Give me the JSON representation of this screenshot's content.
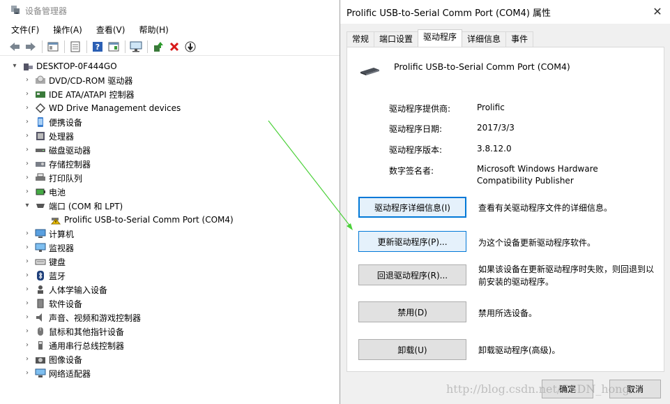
{
  "device_manager": {
    "title": "设备管理器",
    "menu": [
      "文件(F)",
      "操作(A)",
      "查看(V)",
      "帮助(H)"
    ],
    "toolbar_icons": [
      "back-arrow-icon",
      "forward-arrow-icon",
      "show-hide-icon",
      "properties-icon",
      "help-icon",
      "view-icon",
      "monitor-icon",
      "update-driver-icon",
      "uninstall-x-icon",
      "download-icon"
    ],
    "tree": {
      "root": "DESKTOP-0F444GO",
      "items": [
        {
          "label": "DVD/CD-ROM 驱动器",
          "icon": "dvd-drive-icon"
        },
        {
          "label": "IDE ATA/ATAPI 控制器",
          "icon": "ide-controller-icon"
        },
        {
          "label": "WD Drive Management devices",
          "icon": "wd-device-icon"
        },
        {
          "label": "便携设备",
          "icon": "portable-device-icon"
        },
        {
          "label": "处理器",
          "icon": "processor-icon"
        },
        {
          "label": "磁盘驱动器",
          "icon": "disk-drive-icon"
        },
        {
          "label": "存储控制器",
          "icon": "storage-controller-icon"
        },
        {
          "label": "打印队列",
          "icon": "printer-icon"
        },
        {
          "label": "电池",
          "icon": "battery-icon"
        },
        {
          "label": "端口 (COM 和 LPT)",
          "icon": "port-icon",
          "expanded": true
        },
        {
          "label": "Prolific USB-to-Serial Comm Port (COM4)",
          "icon": "warning-port-icon",
          "child": true
        },
        {
          "label": "计算机",
          "icon": "computer-icon"
        },
        {
          "label": "监视器",
          "icon": "monitor-icon"
        },
        {
          "label": "键盘",
          "icon": "keyboard-icon"
        },
        {
          "label": "蓝牙",
          "icon": "bluetooth-icon"
        },
        {
          "label": "人体学输入设备",
          "icon": "hid-icon"
        },
        {
          "label": "软件设备",
          "icon": "software-device-icon"
        },
        {
          "label": "声音、视频和游戏控制器",
          "icon": "sound-icon"
        },
        {
          "label": "鼠标和其他指针设备",
          "icon": "mouse-icon"
        },
        {
          "label": "通用串行总线控制器",
          "icon": "usb-icon"
        },
        {
          "label": "图像设备",
          "icon": "camera-icon"
        },
        {
          "label": "网络适配器",
          "icon": "network-icon"
        }
      ]
    }
  },
  "properties_dialog": {
    "title": "Prolific USB-to-Serial Comm Port (COM4) 属性",
    "tabs": [
      "常规",
      "端口设置",
      "驱动程序",
      "详细信息",
      "事件"
    ],
    "active_tab": "驱动程序",
    "device_name": "Prolific USB-to-Serial Comm Port (COM4)",
    "info": [
      {
        "label": "驱动程序提供商:",
        "value": "Prolific"
      },
      {
        "label": "驱动程序日期:",
        "value": "2017/3/3"
      },
      {
        "label": "驱动程序版本:",
        "value": "3.8.12.0"
      },
      {
        "label": "数字签名者:",
        "value": "Microsoft Windows Hardware Compatibility Publisher"
      }
    ],
    "actions": [
      {
        "button": "驱动程序详细信息(I)",
        "desc": "查看有关驱动程序文件的详细信息。"
      },
      {
        "button": "更新驱动程序(P)...",
        "desc": "为这个设备更新驱动程序软件。"
      },
      {
        "button": "回退驱动程序(R)...",
        "desc": "如果该设备在更新驱动程序时失败，则回退到以前安装的驱动程序。"
      },
      {
        "button": "禁用(D)",
        "desc": "禁用所选设备。"
      },
      {
        "button": "卸载(U)",
        "desc": "卸载驱动程序(高级)。"
      }
    ],
    "ok": "确定",
    "cancel": "取消"
  },
  "watermark": "http://blog.csdn.net/CSDN_hong",
  "colors": {
    "accent": "#0078d7",
    "annotation_arrow": "#4cd13a"
  }
}
